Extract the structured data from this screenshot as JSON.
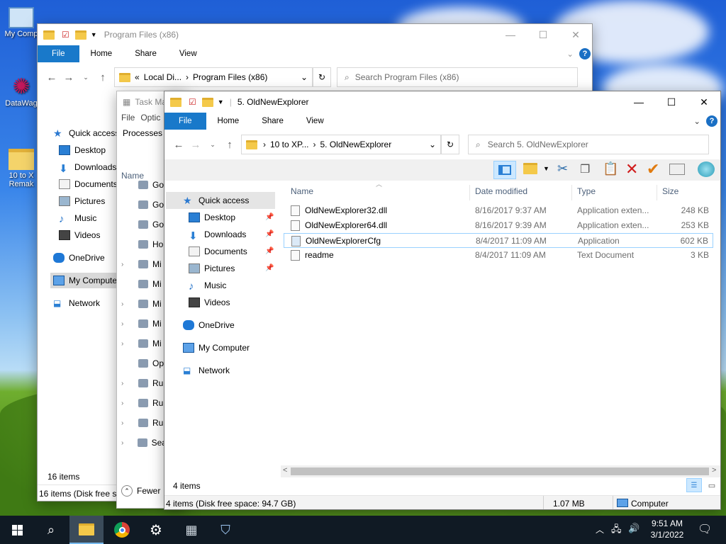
{
  "desktop": {
    "icons": [
      {
        "label": "My Comp",
        "icon": "computer-icon"
      },
      {
        "label": "DataWag",
        "icon": "network-star-icon"
      },
      {
        "label": "10 to X",
        "label2": "Remak",
        "icon": "folder-icon"
      }
    ]
  },
  "window_back": {
    "title": "Program Files (x86)",
    "tabs": {
      "file": "File",
      "home": "Home",
      "share": "Share",
      "view": "View"
    },
    "address": {
      "prefix": "«",
      "part1": "Local Di...",
      "part2": "Program Files (x86)"
    },
    "search_placeholder": "Search Program Files (x86)",
    "nav": {
      "quick_access": "Quick access",
      "desktop": "Desktop",
      "downloads": "Downloads",
      "documents": "Documents",
      "pictures": "Pictures",
      "music": "Music",
      "videos": "Videos",
      "onedrive": "OneDrive",
      "my_computer": "My Compute",
      "network": "Network"
    },
    "status_items": "16 items",
    "status_bar": "16 items (Disk free sp"
  },
  "task_manager": {
    "title": "Task Ma",
    "menu": {
      "file": "File",
      "options": "Optic"
    },
    "tab": "Processes",
    "col_name": "Name",
    "rows": [
      "Go",
      "Go",
      "Go",
      "Ho",
      "Mi",
      "Mi",
      "Mi",
      "Mi",
      "Mi",
      "Op",
      "Ru",
      "Ru",
      "Ru",
      "Sea"
    ],
    "fewer": "Fewer"
  },
  "window_front": {
    "title": "5. OldNewExplorer",
    "tabs": {
      "file": "File",
      "home": "Home",
      "share": "Share",
      "view": "View"
    },
    "address": {
      "part1": "10 to XP...",
      "part2": "5. OldNewExplorer"
    },
    "search_placeholder": "Search 5. OldNewExplorer",
    "nav": {
      "quick_access": "Quick access",
      "desktop": "Desktop",
      "downloads": "Downloads",
      "documents": "Documents",
      "pictures": "Pictures",
      "music": "Music",
      "videos": "Videos",
      "onedrive": "OneDrive",
      "my_computer": "My Computer",
      "network": "Network"
    },
    "columns": {
      "name": "Name",
      "date": "Date modified",
      "type": "Type",
      "size": "Size"
    },
    "files": [
      {
        "name": "OldNewExplorer32.dll",
        "date": "8/16/2017 9:37 AM",
        "type": "Application exten...",
        "size": "248 KB",
        "icon": "dll-icon"
      },
      {
        "name": "OldNewExplorer64.dll",
        "date": "8/16/2017 9:39 AM",
        "type": "Application exten...",
        "size": "253 KB",
        "icon": "dll-icon"
      },
      {
        "name": "OldNewExplorerCfg",
        "date": "8/4/2017 11:09 AM",
        "type": "Application",
        "size": "602 KB",
        "icon": "app-icon"
      },
      {
        "name": "readme",
        "date": "8/4/2017 11:09 AM",
        "type": "Text Document",
        "size": "3 KB",
        "icon": "text-doc-icon"
      }
    ],
    "item_count": "4 items",
    "statusbar": {
      "left": "4 items (Disk free space: 94.7 GB)",
      "size": "1.07 MB",
      "location": "Computer"
    }
  },
  "taskbar": {
    "time": "9:51 AM",
    "date": "3/1/2022"
  },
  "colors": {
    "accent": "#1979ca",
    "selection": "#cce8ff",
    "taskbar": "#101a24"
  }
}
